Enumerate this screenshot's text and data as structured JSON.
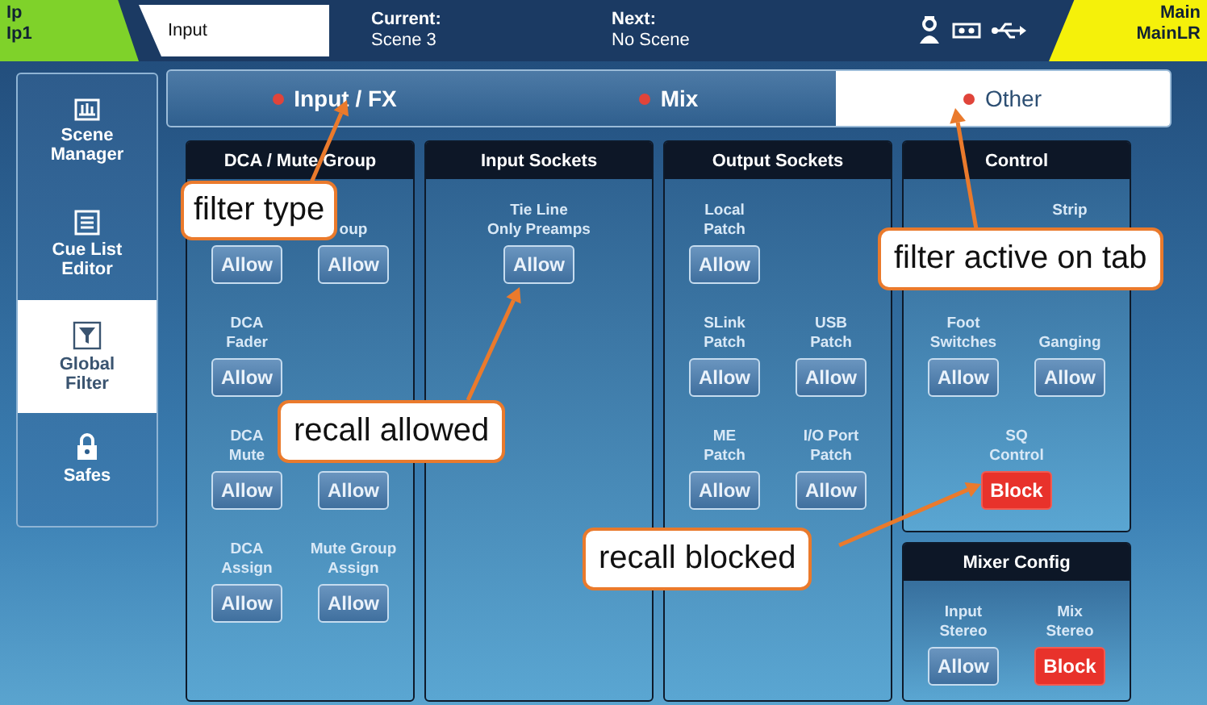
{
  "header": {
    "layer": "Ip",
    "channel": "Ip1",
    "channel_name": "Input",
    "current_label": "Current:",
    "current_scene": "Scene 3",
    "next_label": "Next:",
    "next_scene": "No Scene",
    "mix_label": "Main",
    "mix_name": "MainLR"
  },
  "sidebar": {
    "items": [
      {
        "label": "Scene\nManager",
        "selected": false
      },
      {
        "label": "Cue List\nEditor",
        "selected": false
      },
      {
        "label": "Global\nFilter",
        "selected": true
      },
      {
        "label": "Safes",
        "selected": false
      }
    ]
  },
  "tabs": [
    {
      "label": "Input / FX",
      "filter_active": true,
      "selected": false
    },
    {
      "label": "Mix",
      "filter_active": true,
      "selected": false
    },
    {
      "label": "Other",
      "filter_active": true,
      "selected": true
    }
  ],
  "panels": [
    {
      "title": "DCA / Mute Group",
      "rows": [
        [
          {
            "button": "Allow",
            "blocked": false
          },
          {
            "label": "oup",
            "button": "Allow",
            "blocked": false
          }
        ],
        [
          {
            "label": "DCA\nFader",
            "button": "Allow",
            "blocked": false
          },
          null
        ],
        [
          {
            "label": "DCA\nMute",
            "button": "Allow",
            "blocked": false
          },
          {
            "button": "Allow",
            "blocked": false
          }
        ],
        [
          {
            "label": "DCA\nAssign",
            "button": "Allow",
            "blocked": false
          },
          {
            "label": "Mute Group\nAssign",
            "button": "Allow",
            "blocked": false
          }
        ]
      ]
    },
    {
      "title": "Input Sockets",
      "rows": [
        [
          {
            "label": "Tie Line\nOnly Preamps",
            "button": "Allow",
            "blocked": false
          }
        ]
      ]
    },
    {
      "title": "Output Sockets",
      "rows": [
        [
          {
            "label": "Local\nPatch",
            "button": "Allow",
            "blocked": false
          },
          null
        ],
        [
          {
            "label": "SLink\nPatch",
            "button": "Allow",
            "blocked": false
          },
          {
            "label": "USB\nPatch",
            "button": "Allow",
            "blocked": false
          }
        ],
        [
          {
            "label": "ME\nPatch",
            "button": "Allow",
            "blocked": false
          },
          {
            "label": "I/O Port\nPatch",
            "button": "Allow",
            "blocked": false
          }
        ]
      ]
    },
    {
      "title": "Control",
      "rows": [
        [
          null,
          {
            "label": "Strip"
          }
        ],
        [
          {
            "label": "Foot\nSwitches",
            "button": "Allow",
            "blocked": false
          },
          {
            "label": "Ganging",
            "button": "Allow",
            "blocked": false
          }
        ],
        [
          {
            "label": "SQ\nControl",
            "button": "Block",
            "blocked": true
          }
        ]
      ],
      "sub_panel": {
        "title": "Mixer Config",
        "rows": [
          [
            {
              "label": "Input\nStereo",
              "button": "Allow",
              "blocked": false
            },
            {
              "label": "Mix\nStereo",
              "button": "Block",
              "blocked": true
            }
          ]
        ]
      }
    }
  ],
  "callouts": [
    {
      "text": "filter type"
    },
    {
      "text": "recall allowed"
    },
    {
      "text": "filter active on tab"
    },
    {
      "text": "recall blocked"
    }
  ]
}
